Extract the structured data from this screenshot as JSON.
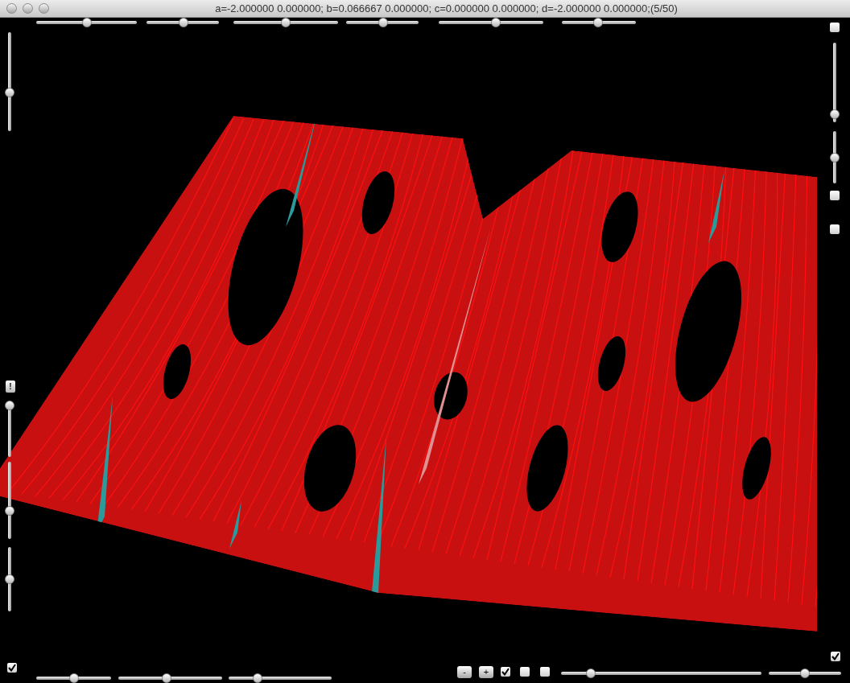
{
  "window": {
    "title": "a=-2.000000 0.000000; b=0.066667 0.000000; c=0.000000 0.000000; d=-2.000000 0.000000;(5/50)"
  },
  "top_sliders": [
    {
      "level": 0.5
    },
    {
      "level": 0.51
    },
    {
      "level": 0.5
    },
    {
      "level": 0.51
    },
    {
      "level": 0.55
    },
    {
      "level": 0.49
    }
  ],
  "top_right_checkbox": {
    "checked": false
  },
  "right_sliders": [
    {
      "level": 0.05
    },
    {
      "level": 0.5
    }
  ],
  "right_checkboxes": [
    {
      "checked": false
    },
    {
      "checked": false
    }
  ],
  "left_top_slider": {
    "level": 0.38
  },
  "left_button": {
    "label": "!"
  },
  "left_sliders": [
    {
      "level": 1
    },
    {
      "level": 0.35
    },
    {
      "level": 0.5
    }
  ],
  "left_checkbox": {
    "checked": true
  },
  "bottom_sliders": [
    {
      "level": 0.5
    },
    {
      "level": 0.46
    },
    {
      "level": 0.26
    }
  ],
  "zoom_buttons": [
    {
      "label": "-"
    },
    {
      "label": "+"
    }
  ],
  "bottom_checkboxes": [
    {
      "checked": true
    },
    {
      "checked": false
    },
    {
      "checked": false
    }
  ],
  "bottom_right_sliders": [
    {
      "level": 0.13
    },
    {
      "level": 0.5
    }
  ],
  "corner_checkbox": {
    "checked": true
  }
}
